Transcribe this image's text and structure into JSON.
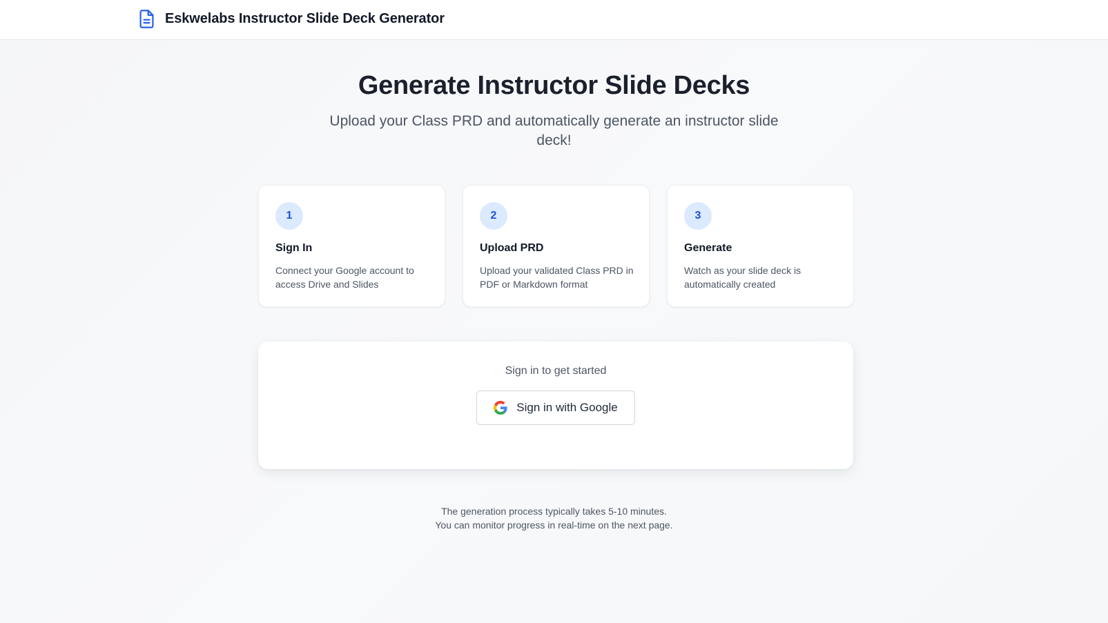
{
  "app": {
    "title": "Eskwelabs Instructor Slide Deck Generator",
    "logo_icon": "document-icon",
    "accent_color": "#2563eb"
  },
  "hero": {
    "title": "Generate Instructor Slide Decks",
    "subtitle": "Upload your Class PRD and automatically generate an instructor slide deck!"
  },
  "steps": [
    {
      "number": "1",
      "title": "Sign In",
      "description": "Connect your Google account to access Drive and Slides"
    },
    {
      "number": "2",
      "title": "Upload PRD",
      "description": "Upload your validated Class PRD in PDF or Markdown format"
    },
    {
      "number": "3",
      "title": "Generate",
      "description": "Watch as your slide deck is automatically created"
    }
  ],
  "signin": {
    "prompt": "Sign in to get started",
    "button_label": "Sign in with Google",
    "button_icon": "google-g-icon"
  },
  "footer": {
    "line1": "The generation process typically takes 5-10 minutes.",
    "line2": "You can monitor progress in real-time on the next page."
  }
}
